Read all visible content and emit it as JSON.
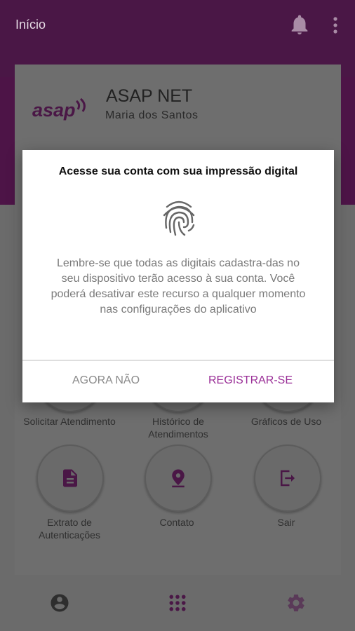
{
  "header": {
    "title": "Início",
    "bell_icon": "notifications-bell-icon",
    "menu_icon": "more-vertical-icon"
  },
  "brand": {
    "logo_text": "asap",
    "company": "ASAP NET",
    "user": "Maria dos Santos"
  },
  "menu": {
    "items": [
      {
        "label": "Solicitar Atendimento"
      },
      {
        "label": "Histórico de Atendimentos"
      },
      {
        "label": "Gráficos de Uso"
      },
      {
        "label": "Extrato de Autenticações"
      },
      {
        "label": "Contato"
      },
      {
        "label": "Sair"
      }
    ]
  },
  "dialog": {
    "title": "Acesse sua conta com sua impressão digital",
    "body": "Lembre-se que todas as digitais cadastra-das no seu dispositivo terão acesso à sua conta. Você poderá desativar este recurso a qualquer momento nas configurações do aplicativo",
    "negative_label": "AGORA NÃO",
    "positive_label": "REGISTRAR-SE"
  },
  "colors": {
    "header": "#4a1746",
    "accent": "#9a2f97",
    "overlay": "#6b6b6b"
  }
}
